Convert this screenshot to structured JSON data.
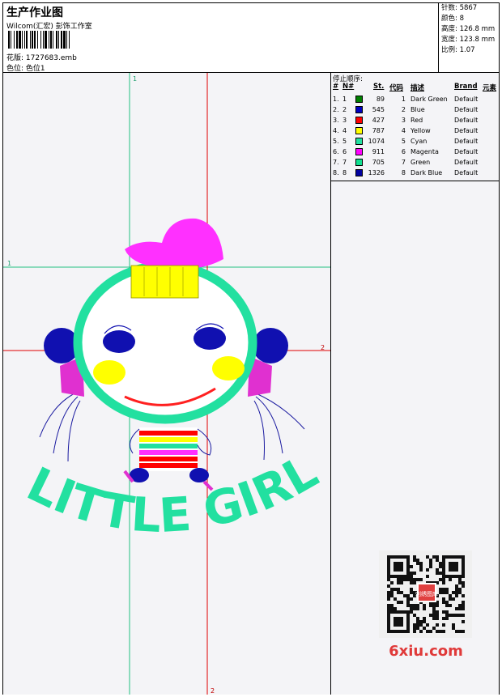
{
  "header": {
    "title": "生产作业图",
    "company": "Wilcom(汇宏) 彭饰工作室",
    "file_label": "花版:",
    "file_name": "1727683.emb",
    "color_label": "色位:",
    "color_value": "色位1"
  },
  "stats": [
    {
      "label": "针数:",
      "value": "5867"
    },
    {
      "label": "颜色:",
      "value": "8"
    },
    {
      "label": "高度:",
      "value": "126.8 mm"
    },
    {
      "label": "宽度:",
      "value": "123.8 mm"
    },
    {
      "label": "比例:",
      "value": "1.07"
    }
  ],
  "stop_sequence": {
    "title": "停止顺序:",
    "headers": [
      "#",
      "N#",
      "St.",
      "代码",
      "描述",
      "Brand",
      "元素"
    ],
    "rows": [
      {
        "idx": "1.",
        "n": "1",
        "color": "#008000",
        "st": "89",
        "code": "1",
        "desc": "Dark Green",
        "brand": "Default"
      },
      {
        "idx": "2.",
        "n": "2",
        "color": "#0000c0",
        "st": "545",
        "code": "2",
        "desc": "Blue",
        "brand": "Default"
      },
      {
        "idx": "3.",
        "n": "3",
        "color": "#ff0000",
        "st": "427",
        "code": "3",
        "desc": "Red",
        "brand": "Default"
      },
      {
        "idx": "4.",
        "n": "4",
        "color": "#ffff00",
        "st": "787",
        "code": "4",
        "desc": "Yellow",
        "brand": "Default"
      },
      {
        "idx": "5.",
        "n": "5",
        "color": "#22e0a0",
        "st": "1074",
        "code": "5",
        "desc": "Cyan",
        "brand": "Default"
      },
      {
        "idx": "6.",
        "n": "6",
        "color": "#ff00ff",
        "st": "911",
        "code": "6",
        "desc": "Magenta",
        "brand": "Default"
      },
      {
        "idx": "7.",
        "n": "7",
        "color": "#10e090",
        "st": "705",
        "code": "7",
        "desc": "Green",
        "brand": "Default"
      },
      {
        "idx": "8.",
        "n": "8",
        "color": "#0000a0",
        "st": "1326",
        "code": "8",
        "desc": "Dark Blue",
        "brand": "Default"
      }
    ]
  },
  "design": {
    "text": "LITTLE GIRL",
    "guide_labels": {
      "one": "1",
      "two": "2"
    }
  },
  "watermark": {
    "site": "6xiu.com",
    "stamp": "刺绣图库"
  }
}
